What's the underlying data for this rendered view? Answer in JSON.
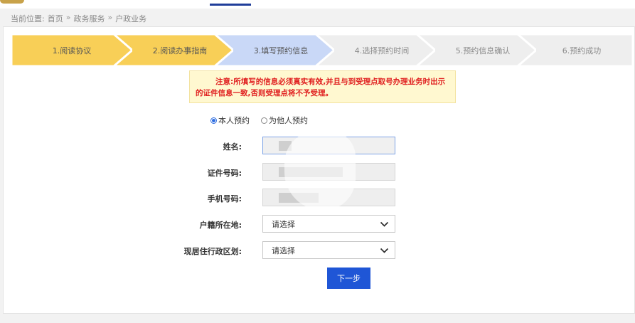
{
  "breadcrumb": {
    "prefix": "当前位置:",
    "items": [
      "首页",
      "政务服务",
      "户政业务"
    ],
    "separator": "»"
  },
  "steps": [
    {
      "label": "1.阅读协议",
      "state": "done"
    },
    {
      "label": "2.阅读办事指南",
      "state": "done"
    },
    {
      "label": "3.填写预约信息",
      "state": "current"
    },
    {
      "label": "4.选择预约时间",
      "state": "pending"
    },
    {
      "label": "5.预约信息确认",
      "state": "pending"
    },
    {
      "label": "6.预约成功",
      "state": "pending"
    }
  ],
  "notice": {
    "line1": "注意:所填写的信息必须真实有效,并且与到受理点取号办理业务时出示",
    "line2": "的证件信息一致,否则受理点将不予受理。"
  },
  "booking_type": {
    "options": [
      "本人预约",
      "为他人预约"
    ],
    "selected": "本人预约"
  },
  "form": {
    "name_label": "姓名:",
    "id_label": "证件号码:",
    "phone_label": "手机号码:",
    "huji_label": "户籍所在地:",
    "huji_value": "请选择",
    "district_label": "现居住行政区划:",
    "district_value": "请选择"
  },
  "next_button": "下一步",
  "colors": {
    "done": "#f8cf57",
    "current": "#c9d8f7",
    "pending": "#eeeeee",
    "notice_text": "#e02020",
    "notice_bg": "#fff8d0",
    "primary": "#1f56d6"
  }
}
